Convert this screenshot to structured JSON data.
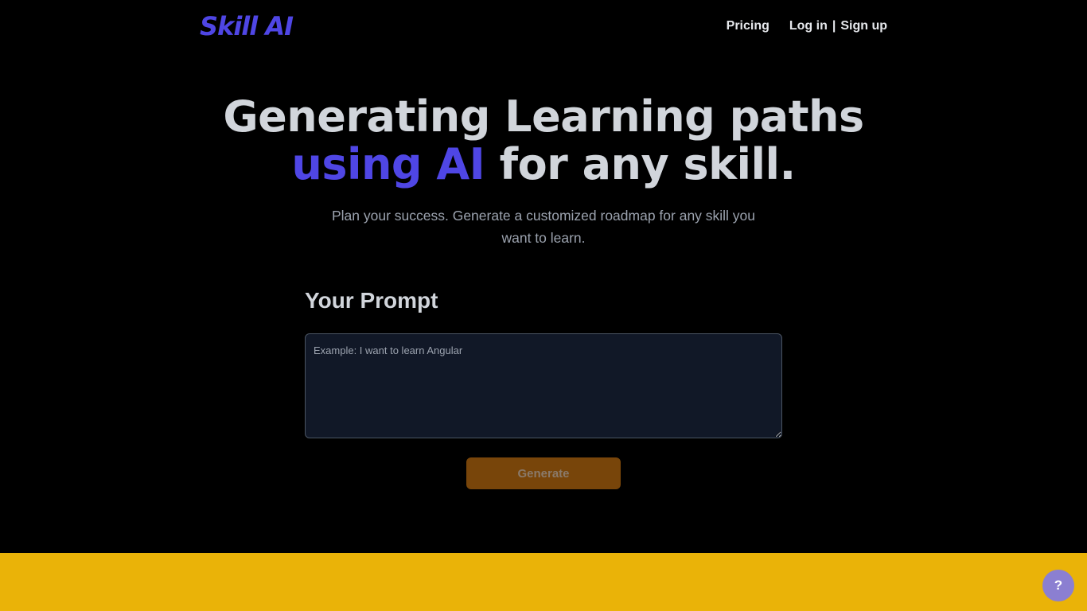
{
  "header": {
    "logo": "Skill AI",
    "nav": {
      "pricing": "Pricing",
      "login": "Log in",
      "separator": "|",
      "signup": "Sign up"
    }
  },
  "hero": {
    "title_line1": "Generating Learning paths",
    "title_accent": "using AI",
    "title_rest": " for any skill.",
    "subtitle": "Plan your success. Generate a customized roadmap for any skill you want to learn."
  },
  "prompt": {
    "label": "Your Prompt",
    "placeholder": "Example: I want to learn Angular",
    "value": ""
  },
  "actions": {
    "generate_label": "Generate"
  },
  "help": {
    "label": "?"
  },
  "colors": {
    "background": "#000000",
    "accent": "#4f46e5",
    "input_bg": "#111827",
    "button_bg": "#78450a",
    "band": "#eab308",
    "help_bg": "#8b7fd1"
  }
}
